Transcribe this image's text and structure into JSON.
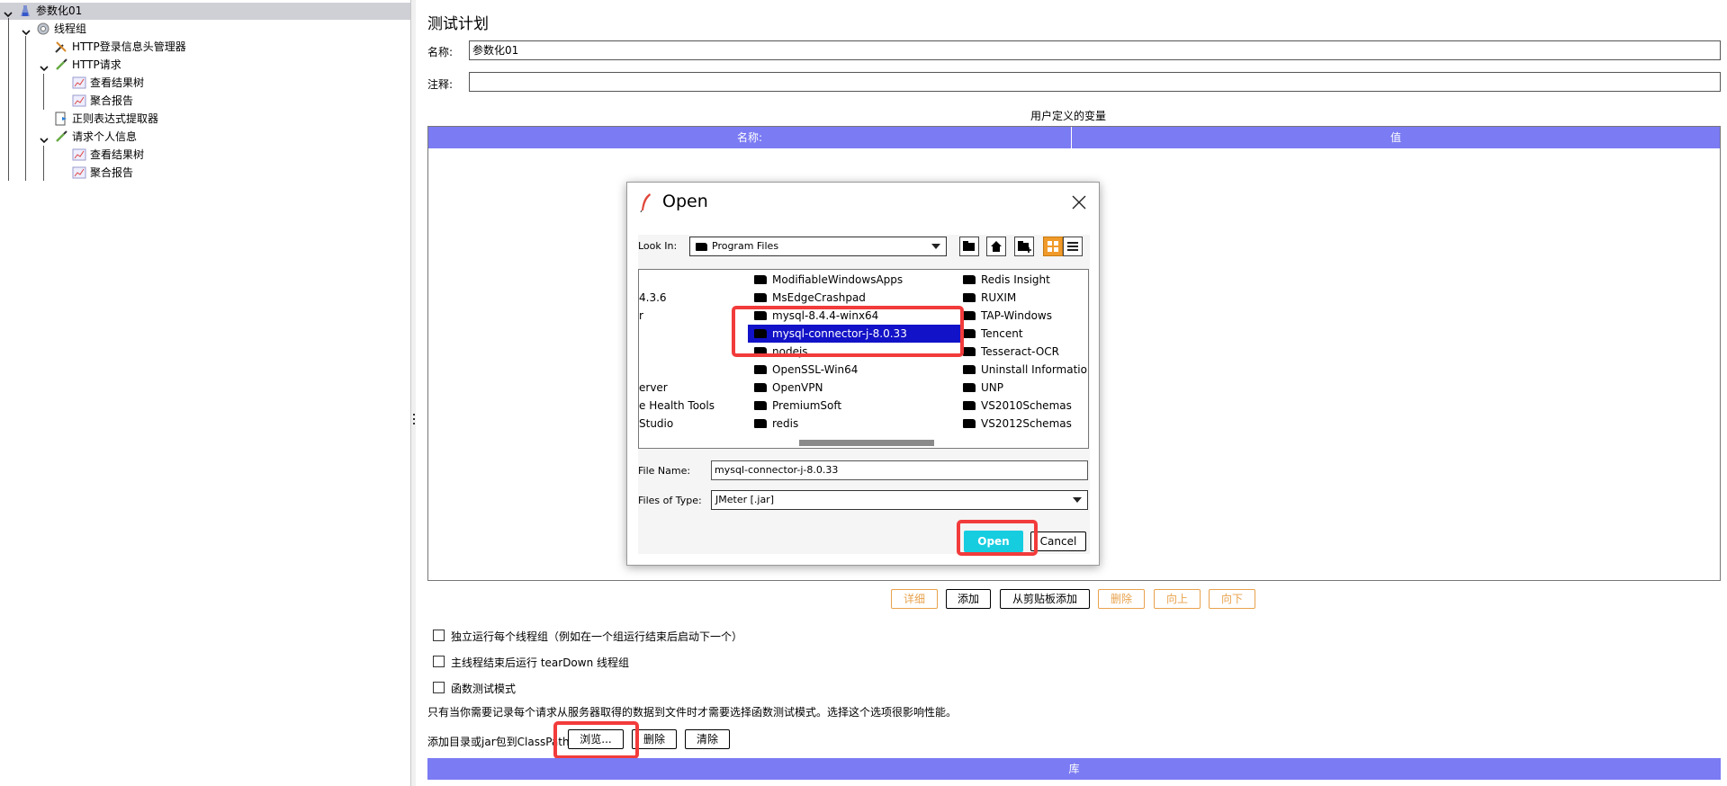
{
  "tree": {
    "items": [
      {
        "label": "参数化01",
        "icon": "test-plan-icon",
        "depth": 0,
        "expanded": true,
        "selected": true
      },
      {
        "label": "线程组",
        "icon": "gear-icon",
        "depth": 1,
        "expanded": true
      },
      {
        "label": "HTTP登录信息头管理器",
        "icon": "wrench-icon",
        "depth": 2
      },
      {
        "label": "HTTP请求",
        "icon": "pipette-icon",
        "depth": 2,
        "expanded": true
      },
      {
        "label": "查看结果树",
        "icon": "chart-icon",
        "depth": 3
      },
      {
        "label": "聚合报告",
        "icon": "chart-icon",
        "depth": 3
      },
      {
        "label": "正则表达式提取器",
        "icon": "extractor-icon",
        "depth": 2
      },
      {
        "label": "请求个人信息",
        "icon": "pipette-icon",
        "depth": 2,
        "expanded": true
      },
      {
        "label": "查看结果树",
        "icon": "chart-icon",
        "depth": 3
      },
      {
        "label": "聚合报告",
        "icon": "chart-icon",
        "depth": 3
      }
    ]
  },
  "panel": {
    "title": "测试计划",
    "name_label": "名称:",
    "name_value": "参数化01",
    "comment_label": "注释:",
    "comment_value": "",
    "vars_title": "用户定义的变量",
    "vars_columns": [
      "名称:",
      "值"
    ],
    "buttons": [
      {
        "label": "详细",
        "enabled": false
      },
      {
        "label": "添加",
        "enabled": true
      },
      {
        "label": "从剪贴板添加",
        "enabled": true
      },
      {
        "label": "删除",
        "enabled": false
      },
      {
        "label": "向上",
        "enabled": false
      },
      {
        "label": "向下",
        "enabled": false
      }
    ],
    "checkboxes": [
      {
        "label": "独立运行每个线程组（例如在一个组运行结束后启动下一个）",
        "checked": false
      },
      {
        "label": "主线程结束后运行 tearDown 线程组",
        "checked": false
      },
      {
        "label": "函数测试模式",
        "checked": false
      }
    ],
    "note": "只有当你需要记录每个请求从服务器取得的数据到文件时才需要选择函数测试模式。选择这个选项很影响性能。",
    "classpath_label": "添加目录或jar包到ClassPath",
    "classpath_buttons": [
      "浏览...",
      "删除",
      "清除"
    ],
    "lib_header": "库"
  },
  "dialog": {
    "title": "Open",
    "look_in_label": "Look In:",
    "look_in_value": "Program Files",
    "file_columns": [
      [
        "",
        "4.3.6",
        "r",
        "",
        "",
        "",
        "erver",
        "e Health Tools",
        " Studio"
      ],
      [
        "ModifiableWindowsApps",
        "MsEdgeCrashpad",
        "mysql-8.4.4-winx64",
        "mysql-connector-j-8.0.33",
        "nodejs",
        "OpenSSL-Win64",
        "OpenVPN",
        "PremiumSoft",
        "redis"
      ],
      [
        "Redis Insight",
        "RUXIM",
        "TAP-Windows",
        "Tencent",
        "Tesseract-OCR",
        "Uninstall Information",
        "UNP",
        "VS2010Schemas",
        "VS2012Schemas"
      ]
    ],
    "selected_file": "mysql-connector-j-8.0.33",
    "file_name_label": "File Name:",
    "file_name_value": "mysql-connector-j-8.0.33",
    "file_type_label": "Files of Type:",
    "file_type_value": "JMeter [.jar]",
    "open_label": "Open",
    "cancel_label": "Cancel"
  },
  "colors": {
    "header_blue": "#7b7bf3",
    "selection_blue": "#1212c8",
    "open_cyan": "#16cde0",
    "highlight_red": "#f23b3b",
    "disabled_orange": "#e8a24d"
  }
}
